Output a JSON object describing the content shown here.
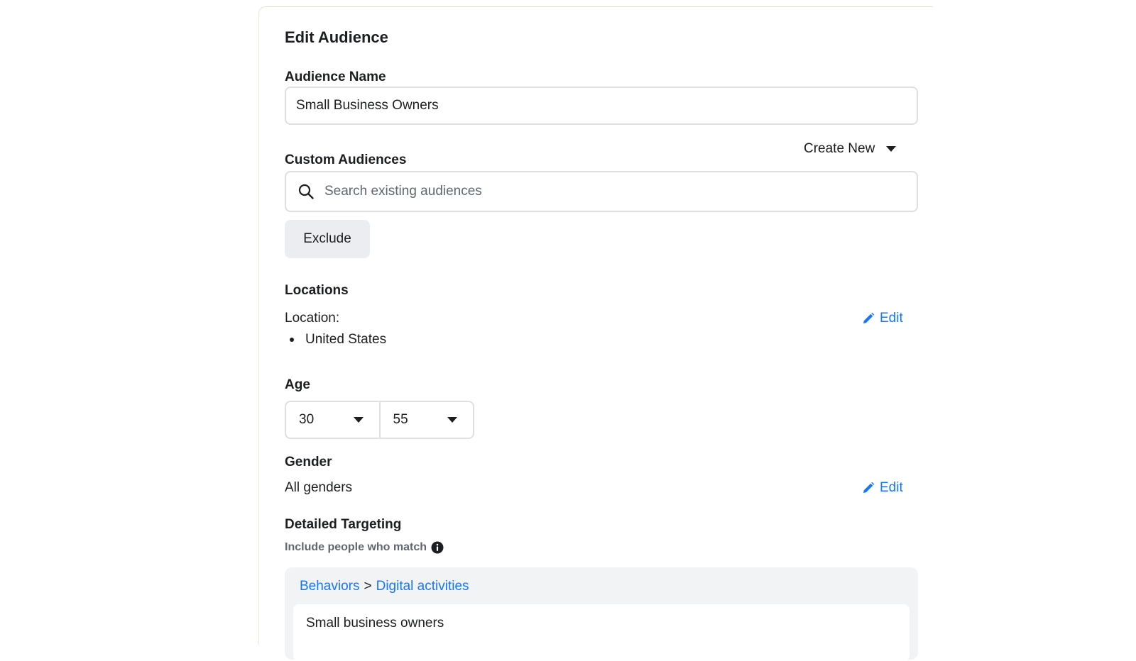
{
  "panel": {
    "title": "Edit Audience",
    "audience_name": {
      "label": "Audience Name",
      "value": "Small Business Owners"
    },
    "custom_audiences": {
      "label": "Custom Audiences",
      "create_new_label": "Create New",
      "search_placeholder": "Search existing audiences",
      "exclude_label": "Exclude"
    },
    "locations": {
      "label": "Locations",
      "location_label": "Location:",
      "items": [
        "United States"
      ],
      "edit_label": "Edit"
    },
    "age": {
      "label": "Age",
      "min": "30",
      "max": "55"
    },
    "gender": {
      "label": "Gender",
      "value": "All genders",
      "edit_label": "Edit"
    },
    "detailed_targeting": {
      "label": "Detailed Targeting",
      "note": "Include people who match",
      "breadcrumb": {
        "category": "Behaviors",
        "separator": ">",
        "subcategory": "Digital activities"
      },
      "item": "Small business owners"
    }
  },
  "colors": {
    "link": "#1877f2",
    "text": "#1c1e21",
    "muted": "#606770",
    "border": "#dddfe3",
    "button_bg": "#ebedf0",
    "targeting_bg": "#f2f3f5"
  },
  "icons": {
    "search": "search-icon",
    "pencil": "pencil-icon",
    "info": "info-icon",
    "caret": "caret-down-icon"
  }
}
